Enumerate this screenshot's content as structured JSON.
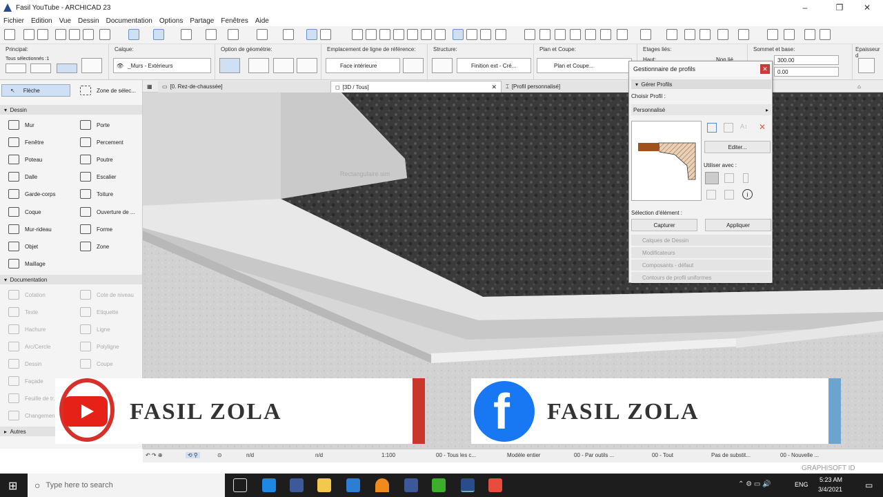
{
  "window": {
    "title": "Fasil YouTube - ARCHICAD 23"
  },
  "menu": [
    "Fichier",
    "Edition",
    "Vue",
    "Dessin",
    "Documentation",
    "Options",
    "Partage",
    "Fenêtres",
    "Aide"
  ],
  "infobox": {
    "principal": {
      "title": "Principal:",
      "selected": "Tous sélectionnés :1"
    },
    "calque": {
      "title": "Calque:",
      "value": "_Murs - Extérieurs"
    },
    "geometrie": {
      "title": "Option de géométrie:"
    },
    "ligne_ref": {
      "title": "Emplacement de ligne de référence:",
      "value": "Face intérieure"
    },
    "structure": {
      "title": "Structure:",
      "value": "Finition ext - Cré..."
    },
    "plan_coupe": {
      "title": "Plan et Coupe:",
      "value": "Plan et Coupe..."
    },
    "etages": {
      "title": "Etages liés:",
      "haut": "Haut:",
      "non_lie": "Non lié"
    },
    "sommet": {
      "title": "Sommet et base:",
      "top_value": "300.00",
      "base_value": "0.00"
    },
    "epaisseur": {
      "title": "Epaisseur d"
    }
  },
  "tabs": [
    {
      "label": "[0. Rez-de-chaussée]"
    },
    {
      "label": "[3D / Tous]",
      "close": "✕"
    },
    {
      "label": "[Profil personnalisé]"
    }
  ],
  "toolbox": {
    "top": [
      {
        "label": "Flèche"
      },
      {
        "label": "Zone de sélec..."
      }
    ],
    "dessin_title": "Dessin",
    "dessin": [
      {
        "label": "Mur"
      },
      {
        "label": "Porte"
      },
      {
        "label": "Fenêtre"
      },
      {
        "label": "Percement"
      },
      {
        "label": "Poteau"
      },
      {
        "label": "Poutre"
      },
      {
        "label": "Dalle"
      },
      {
        "label": "Escalier"
      },
      {
        "label": "Garde-corps"
      },
      {
        "label": "Toiture"
      },
      {
        "label": "Coque"
      },
      {
        "label": "Ouverture de ..."
      },
      {
        "label": "Mur-rideau"
      },
      {
        "label": "Forme"
      },
      {
        "label": "Objet"
      },
      {
        "label": "Zone"
      },
      {
        "label": "Maillage"
      }
    ],
    "doc_title": "Documentation",
    "documentation": [
      {
        "label": "Cotation"
      },
      {
        "label": "Cote de niveau"
      },
      {
        "label": "Texte"
      },
      {
        "label": "Etiquette"
      },
      {
        "label": "Hachure"
      },
      {
        "label": "Ligne"
      },
      {
        "label": "Arc/Cercle"
      },
      {
        "label": "Polyligne"
      },
      {
        "label": "Dessin"
      },
      {
        "label": "Coupe"
      },
      {
        "label": "Façade"
      },
      {
        "label": "Feuille de tr..."
      },
      {
        "label": "Changement"
      }
    ],
    "autres_title": "Autres"
  },
  "viewport": {
    "ghost_label": "Rectangulaire sim"
  },
  "palette": {
    "title": "Gestionnaire de profils",
    "section_manage": "Gérer Profils",
    "choose_label": "Choisir Profil :",
    "choose_value": "Personnalisé",
    "edit_button": "Editer...",
    "use_with": "Utiliser avec :",
    "selection_label": "Sélection d'élément :",
    "capture_button": "Capturer",
    "apply_button": "Appliquer",
    "sections": [
      "Calques de Dessin",
      "Modificateurs",
      "Composants - défaut",
      "Contours de profil uniformes"
    ]
  },
  "banners": {
    "youtube_name": "FASIL ZOLA",
    "facebook_name": "FASIL ZOLA"
  },
  "statusbar": {
    "nd1": "n/d",
    "nd2": "n/d",
    "scale": "1:100",
    "layer_combo": "00 - Tous les c...",
    "model": "Modèle entier",
    "pen": "00 - Par outils ...",
    "view": "00 - Tout",
    "substitution": "Pas de substit...",
    "renovation": "00 - Nouvelle ...",
    "graphisoft": "GRAPHISOFT ID"
  },
  "taskbar": {
    "search_placeholder": "Type here to search",
    "lang": "ENG",
    "time": "5:23 AM",
    "date": "3/4/2021"
  },
  "colors": {
    "accent": "#0078d7",
    "youtube": "#e62117",
    "facebook": "#1877f2",
    "profile_brown": "#a0521d"
  }
}
